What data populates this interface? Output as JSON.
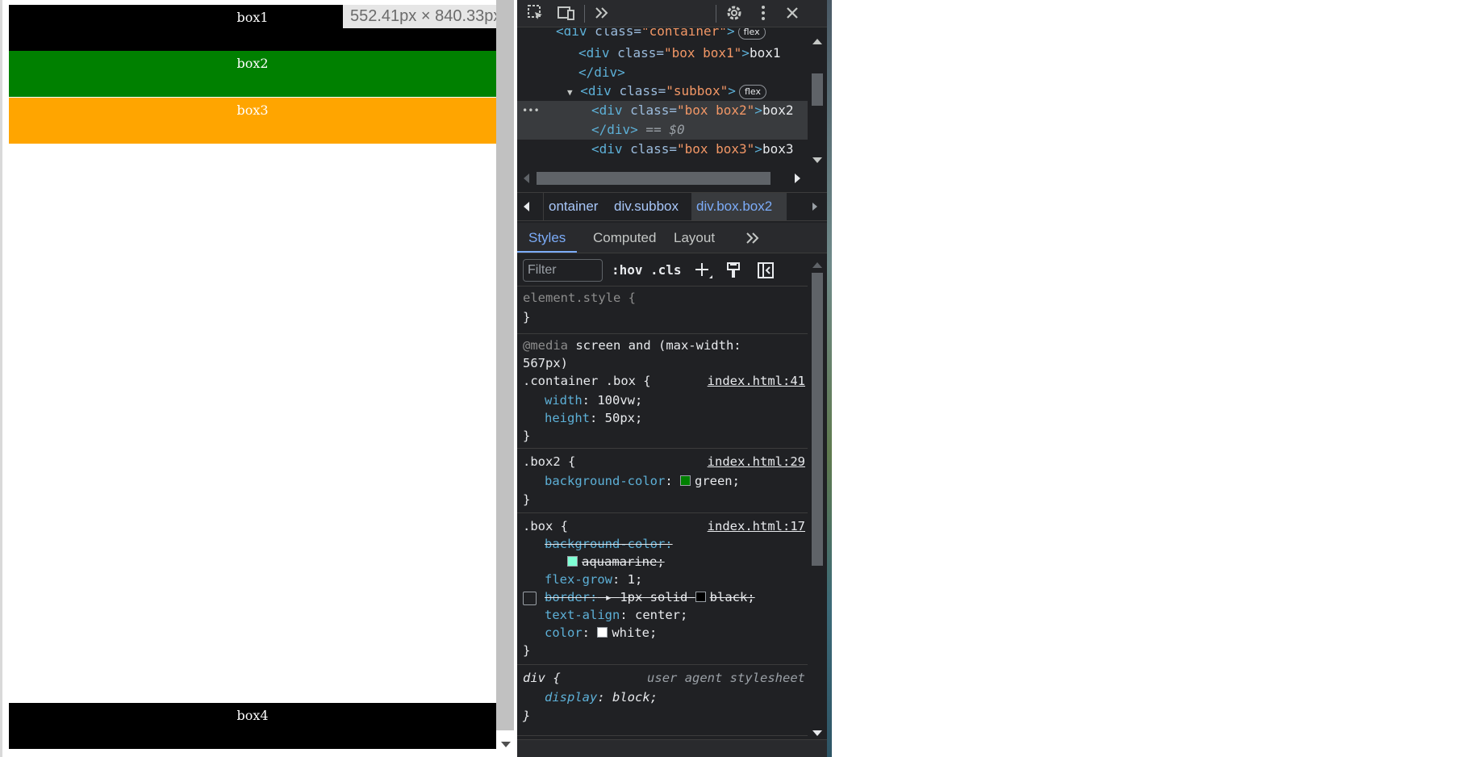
{
  "preview": {
    "boxes": [
      {
        "label": "box1",
        "color": "#000000"
      },
      {
        "label": "box2",
        "color": "#008000"
      },
      {
        "label": "box3",
        "color": "#ffa500"
      },
      {
        "label": "box4",
        "color": "#000000"
      }
    ],
    "dimension_tooltip": "552.41px × 840.33px"
  },
  "devtools": {
    "toolbar": {
      "icons": [
        "inspect-element-icon",
        "device-toggle-icon",
        "more-tabs-icon",
        "settings-icon",
        "kebab-menu-icon",
        "close-icon"
      ]
    },
    "dom": {
      "line0": {
        "open": "<div ",
        "attr": "class=",
        "val": "\"container\"",
        "close": ">",
        "badge": "flex"
      },
      "line1": {
        "open": "<div ",
        "attr": "class=",
        "val": "\"box box1\"",
        "close": ">",
        "text": "box1"
      },
      "line2": {
        "close_tag": "</div>"
      },
      "line3": {
        "open": "<div ",
        "attr": "class=",
        "val": "\"subbox\"",
        "close": ">",
        "badge": "flex"
      },
      "line4": {
        "open": "<div ",
        "attr": "class=",
        "val": "\"box box2\"",
        "close": ">",
        "text": "box2"
      },
      "line5": {
        "close_tag": "</div>",
        "eq": " == ",
        "ref": "$0"
      },
      "line6": {
        "open": "<div ",
        "attr": "class=",
        "val": "\"box box3\"",
        "close": ">",
        "text": "box3"
      },
      "ellipsis": "•••"
    },
    "breadcrumbs": [
      "ontainer",
      "div.subbox",
      "div.box.box2"
    ],
    "tabs": [
      "Styles",
      "Computed",
      "Layout"
    ],
    "styles_toolbar": {
      "filter_placeholder": "Filter",
      "hov": ":hov",
      "cls": ".cls"
    },
    "rules": {
      "element_style": {
        "selector": "element.style {",
        "close": "}"
      },
      "media": {
        "at": "@media",
        "query1": " screen and (max-width:",
        "query2": "567px)",
        "selector": ".container .box {",
        "source": "index.html:41",
        "decls": [
          {
            "prop": "width",
            "value": "100vw;"
          },
          {
            "prop": "height",
            "value": "50px;"
          }
        ],
        "close": "}"
      },
      "box2": {
        "selector": ".box2 {",
        "source": "index.html:29",
        "decl": {
          "prop": "background-color",
          "value": "green;",
          "swatch": "#008000"
        },
        "close": "}"
      },
      "box": {
        "selector": ".box {",
        "source": "index.html:17",
        "bg_prop": "background-color:",
        "bg_value": "aquamarine;",
        "bg_swatch": "#7fffd4",
        "flex_prop": "flex-grow",
        "flex_value": "1;",
        "border_prop": "border:",
        "border_value1": "1px solid",
        "border_value2": "black;",
        "border_swatch": "#000000",
        "align_prop": "text-align",
        "align_value": "center;",
        "color_prop": "color",
        "color_value": "white;",
        "color_swatch": "#ffffff",
        "close": "}"
      },
      "div": {
        "selector": "div {",
        "source": "user agent stylesheet",
        "decl": {
          "prop": "display",
          "value": "block;"
        },
        "close": "}"
      }
    }
  }
}
